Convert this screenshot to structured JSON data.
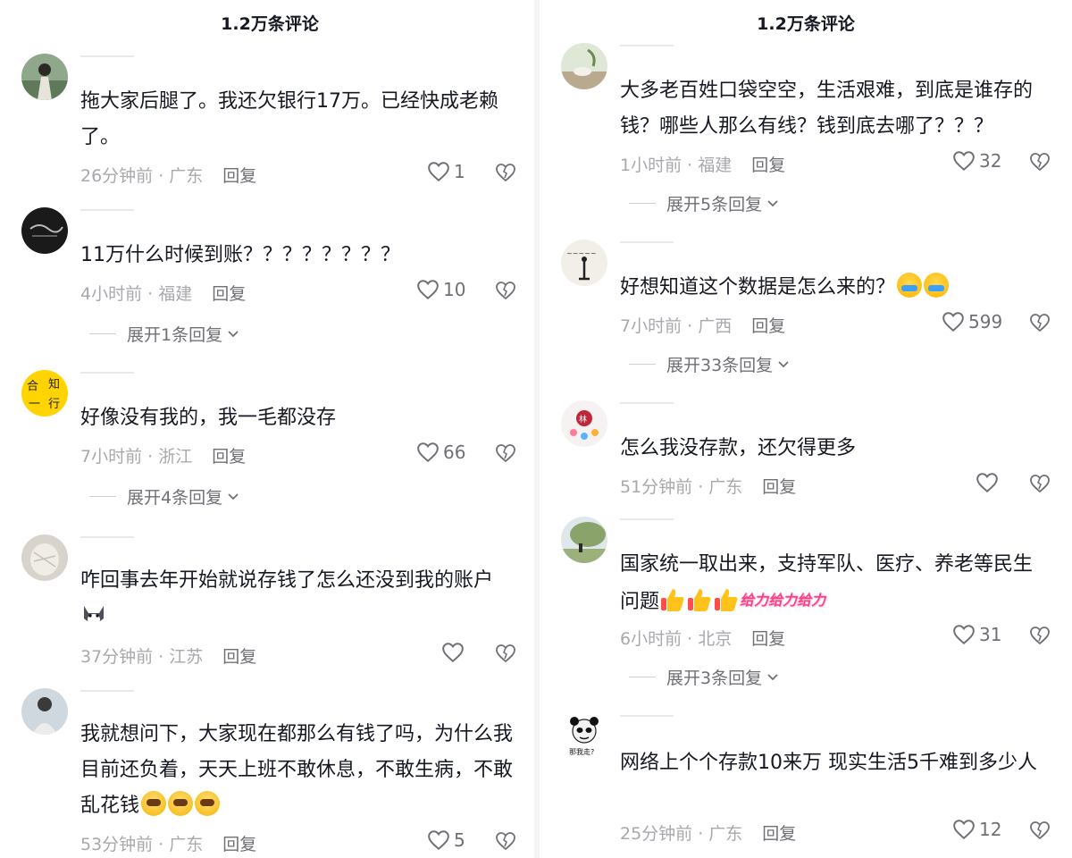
{
  "left": {
    "title": "1.2万条评论",
    "comments": [
      {
        "avatar": "avatar-woman-icon",
        "text": "拖大家后腿了。我还欠银行17万。已经快成老赖了。",
        "time": "26分钟前 · 广东",
        "reply": "回复",
        "likes": "1",
        "expand": ""
      },
      {
        "avatar": "avatar-dark-icon",
        "text": "11万什么时候到账？？？？？？？？",
        "time": "4小时前 · 福建",
        "reply": "回复",
        "likes": "10",
        "expand": "展开1条回复"
      },
      {
        "avatar": "avatar-calligraphy-icon",
        "text": "好像没有我的，我一毛都没存",
        "time": "7小时前 · 浙江",
        "reply": "回复",
        "likes": "66",
        "expand": "展开4条回复"
      },
      {
        "avatar": "avatar-hand-icon",
        "text": "咋回事去年开始就说存钱了怎么还没到我的账户",
        "time": "37分钟前 · 江苏",
        "reply": "回复",
        "likes": "",
        "expand": ""
      },
      {
        "avatar": "avatar-person-icon",
        "text": "我就想问下，大家现在都那么有钱了吗，为什么我目前还负着，天天上班不敢休息，不敢生病，不敢乱花钱",
        "time": "53分钟前 · 广东",
        "reply": "回复",
        "likes": "5",
        "expand": ""
      }
    ]
  },
  "right": {
    "title": "1.2万条评论",
    "comments": [
      {
        "avatar": "avatar-tea-icon",
        "text": "大多老百姓口袋空空，生活艰难，到底是谁存的钱？哪些人那么有线？钱到底去哪了？？？",
        "time": "1小时前 · 福建",
        "reply": "回复",
        "likes": "32",
        "expand": "展开5条回复"
      },
      {
        "avatar": "avatar-ink-icon",
        "text": "好想知道这个数据是怎么来的？",
        "time": "7小时前 · 广西",
        "reply": "回复",
        "likes": "599",
        "expand": "展开33条回复"
      },
      {
        "avatar": "avatar-lin-icon",
        "text": "怎么我没存款，还欠得更多",
        "time": "51分钟前 · 广东",
        "reply": "回复",
        "likes": "",
        "expand": ""
      },
      {
        "avatar": "avatar-tree-icon",
        "text": "国家统一取出来，支持军队、医疗、养老等民生问题",
        "emoji_text": "给力给力给力",
        "time": "6小时前 · 北京",
        "reply": "回复",
        "likes": "31",
        "expand": "展开3条回复"
      },
      {
        "avatar": "avatar-panda-meme-icon",
        "avatar_caption": "那我走?",
        "text": "网络上个个存款10来万 现实生活5千难到多少人",
        "time": "25分钟前 · 广东",
        "reply": "回复",
        "likes": "12",
        "expand": ""
      }
    ]
  },
  "colors": {
    "text": "#161823",
    "meta": "#a8a8ad",
    "action": "#6f6f76"
  }
}
